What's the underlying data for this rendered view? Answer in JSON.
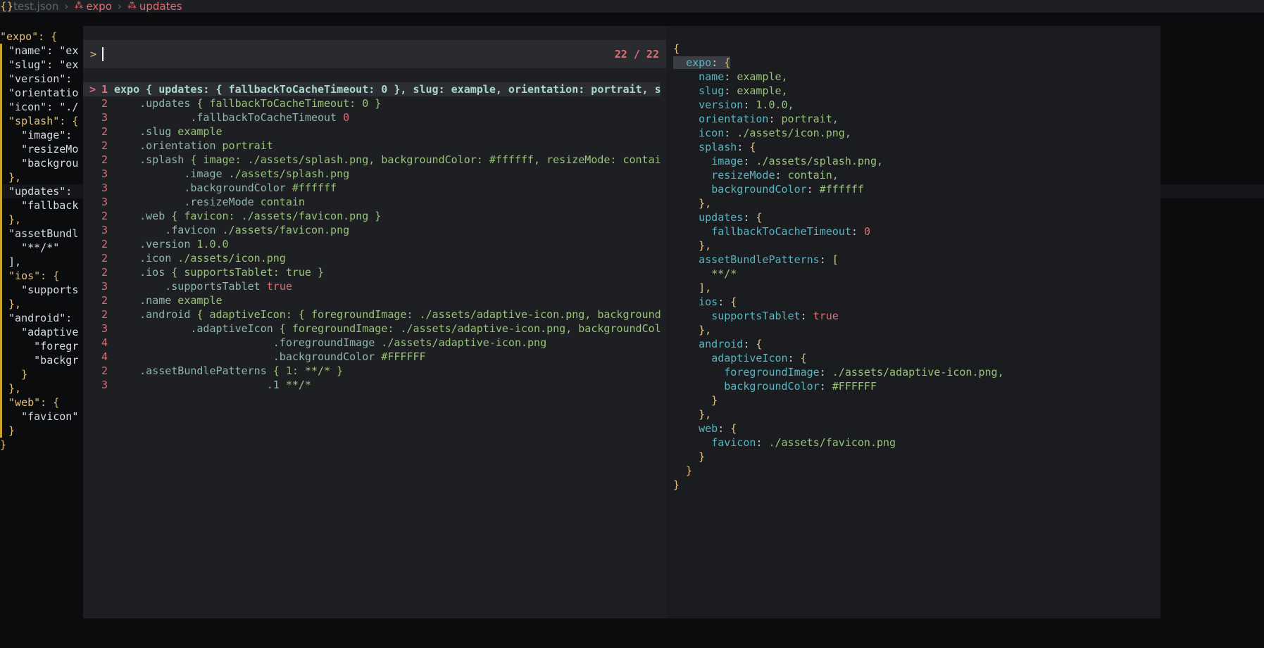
{
  "breadcrumb": {
    "file_icon": "{}",
    "file_name": "test.json",
    "separator": "›",
    "crumbs": [
      "expo",
      "updates"
    ],
    "crumb_icon": "symbol-icon"
  },
  "editor": {
    "lines": [
      "\"expo\": {",
      "  \"name\": \"ex",
      "  \"slug\": \"ex",
      "  \"version\":",
      "  \"orientatio",
      "  \"icon\": \"./",
      "  \"splash\": {",
      "    \"image\":",
      "    \"resizeMo",
      "    \"backgrou",
      "  },",
      "  \"updates\":",
      "    \"fallback",
      "  },",
      "  \"assetBundl",
      "    \"**/*\"",
      "  ],",
      "  \"ios\": {",
      "    \"supports",
      "  },",
      "  \"android\":",
      "    \"adaptive",
      "      \"foregr",
      "      \"backgr",
      "    }",
      "  },",
      "  \"web\": {",
      "    \"favicon\"",
      "  }",
      "}"
    ]
  },
  "picker": {
    "prompt_symbol": ">",
    "count": "22 / 22",
    "results": [
      {
        "level": "1",
        "text": "expo { updates: { fallbackToCacheTimeout: 0 }, slug: example, orientation: portrait, s",
        "selected": true
      },
      {
        "level": "2",
        "text": "    .updates { fallbackToCacheTimeout: 0 }"
      },
      {
        "level": "3",
        "text": "            .fallbackToCacheTimeout 0"
      },
      {
        "level": "2",
        "text": "    .slug example"
      },
      {
        "level": "2",
        "text": "    .orientation portrait"
      },
      {
        "level": "2",
        "text": "    .splash { image: ./assets/splash.png, backgroundColor: #ffffff, resizeMode: contai"
      },
      {
        "level": "3",
        "text": "           .image ./assets/splash.png"
      },
      {
        "level": "3",
        "text": "           .backgroundColor #ffffff"
      },
      {
        "level": "3",
        "text": "           .resizeMode contain"
      },
      {
        "level": "2",
        "text": "    .web { favicon: ./assets/favicon.png }"
      },
      {
        "level": "3",
        "text": "        .favicon ./assets/favicon.png"
      },
      {
        "level": "2",
        "text": "    .version 1.0.0"
      },
      {
        "level": "2",
        "text": "    .icon ./assets/icon.png"
      },
      {
        "level": "2",
        "text": "    .ios { supportsTablet: true }"
      },
      {
        "level": "3",
        "text": "        .supportsTablet true"
      },
      {
        "level": "2",
        "text": "    .name example"
      },
      {
        "level": "2",
        "text": "    .android { adaptiveIcon: { foregroundImage: ./assets/adaptive-icon.png, background"
      },
      {
        "level": "3",
        "text": "            .adaptiveIcon { foregroundImage: ./assets/adaptive-icon.png, backgroundCol"
      },
      {
        "level": "4",
        "text": "                         .foregroundImage ./assets/adaptive-icon.png"
      },
      {
        "level": "4",
        "text": "                         .backgroundColor #FFFFFF"
      },
      {
        "level": "2",
        "text": "    .assetBundlePatterns { 1: **/* }"
      },
      {
        "level": "3",
        "text": "                        .1 **/*"
      }
    ]
  },
  "preview": {
    "lines": [
      "{",
      "  expo: {",
      "    name: example,",
      "    slug: example,",
      "    version: 1.0.0,",
      "    orientation: portrait,",
      "    icon: ./assets/icon.png,",
      "    splash: {",
      "      image: ./assets/splash.png,",
      "      resizeMode: contain,",
      "      backgroundColor: #ffffff",
      "    },",
      "    updates: {",
      "      fallbackToCacheTimeout: 0",
      "    },",
      "    assetBundlePatterns: [",
      "      **/*",
      "    ],",
      "    ios: {",
      "      supportsTablet: true",
      "    },",
      "    android: {",
      "      adaptiveIcon: {",
      "        foregroundImage: ./assets/adaptive-icon.png,",
      "        backgroundColor: #FFFFFF",
      "      }",
      "    },",
      "    web: {",
      "      favicon: ./assets/favicon.png",
      "    }",
      "  }",
      "}"
    ]
  },
  "colors": {
    "accent": "#e06c75",
    "string": "#98c379",
    "key": "#56b6c2",
    "brace": "#e5c07b"
  }
}
